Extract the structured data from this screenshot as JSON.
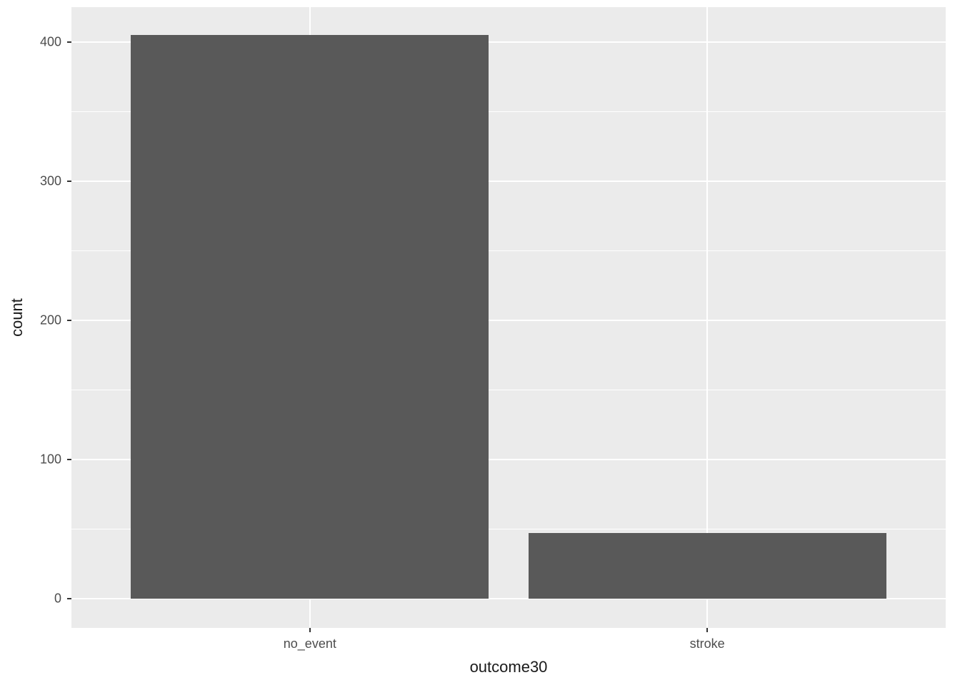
{
  "chart_data": {
    "type": "bar",
    "categories": [
      "no_event",
      "stroke"
    ],
    "values": [
      405,
      47
    ],
    "title": "",
    "xlabel": "outcome30",
    "ylabel": "count",
    "ylim": [
      0,
      425
    ],
    "y_ticks": [
      0,
      100,
      200,
      300,
      400
    ],
    "y_minor": [
      50,
      150,
      250,
      350
    ],
    "bar_color": "#595959",
    "panel_bg": "#ebebeb"
  },
  "axis": {
    "x_ticks": [
      "no_event",
      "stroke"
    ],
    "y_ticks_labels": [
      "0",
      "100",
      "200",
      "300",
      "400"
    ]
  }
}
